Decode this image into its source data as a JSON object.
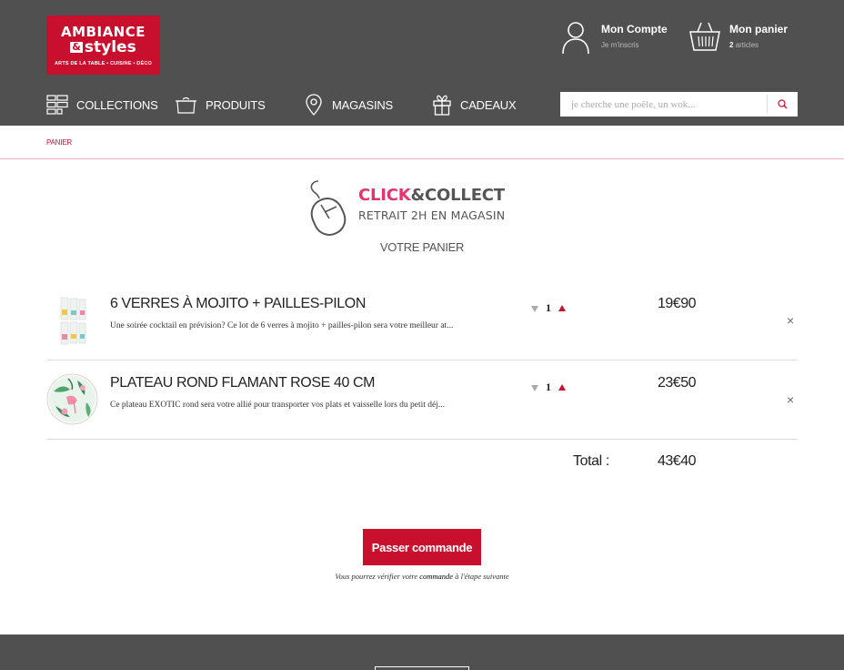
{
  "brand": {
    "logo_line1": "AMBIANCE",
    "logo_amp": "&",
    "logo_line2": "styles",
    "logo_tagline": "ARTS DE LA TABLE • CUISINE • DÉCO"
  },
  "header": {
    "account_title": "Mon Compte",
    "account_sub": "Je m'inscris",
    "basket_title": "Mon panier",
    "basket_count": "2",
    "basket_sub": "articles"
  },
  "nav": {
    "collections": "COLLECTIONS",
    "produits": "PRODUITS",
    "magasins": "MAGASINS",
    "cadeaux": "CADEAUX"
  },
  "search": {
    "placeholder": "je cherche une poêle, un wok..."
  },
  "breadcrumb": "PANIER",
  "click_collect": {
    "click": "CLICK",
    "amp": "&",
    "collect": "COLLECT",
    "subtitle": "RETRAIT 2H EN MAGASIN"
  },
  "page_title": "VOTRE PANIER",
  "cart": {
    "items": [
      {
        "name": "6 VERRES À MOJITO + PAILLES-PILON",
        "description": "Une soirée cocktail en prévision? Ce lot de 6 verres à mojito + pailles-pilon sera votre meilleur at...",
        "quantity": "1",
        "price": "19€90",
        "remove": "×"
      },
      {
        "name": "PLATEAU ROND FLAMANT ROSE 40 CM",
        "description": "Ce plateau EXOTIC rond sera votre allié pour transporter vos plats et vaisselle lors du petit déj...",
        "quantity": "1",
        "price": "23€50",
        "remove": "×"
      }
    ],
    "total_label": "Total :",
    "total_value": "43€40"
  },
  "order": {
    "button": "Passer commande",
    "note_before": "Vous pourrez vérifier votre",
    "note_bold": "commande",
    "note_after": "à l'étape suivante"
  },
  "colors": {
    "brand_red": "#c8102e",
    "header_grey": "#505050",
    "click_pink": "#e6336f"
  }
}
